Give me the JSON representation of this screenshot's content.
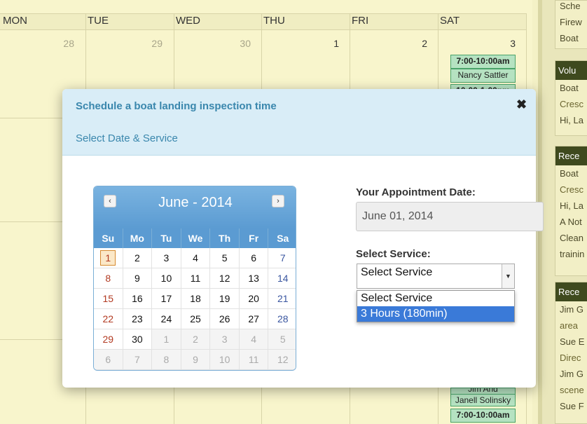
{
  "background": {
    "day_names": [
      "MON",
      "TUE",
      "WED",
      "THU",
      "FRI",
      "SAT"
    ],
    "dates_top_row": [
      {
        "label": "28",
        "muted": true
      },
      {
        "label": "29",
        "muted": true
      },
      {
        "label": "30",
        "muted": true
      },
      {
        "label": "1",
        "muted": false
      },
      {
        "label": "2",
        "muted": false
      },
      {
        "label": "3",
        "muted": false
      }
    ],
    "events_top": [
      "7:00-10:00am",
      "Nancy Sattler",
      "10:00-1:00pm"
    ],
    "events_bottom": [
      "Jim And",
      "Janell Solinsky",
      "7:00-10:00am"
    ]
  },
  "sidebar": {
    "box1": [
      "Sche",
      "Firew",
      "Boat"
    ],
    "box2_head": "Volu",
    "box2": [
      "Boat",
      "Cresc",
      "Hi, La"
    ],
    "box3_head": "Rece",
    "box3": [
      "Boat",
      "Cresc",
      "Hi, La",
      "A Not",
      "Clean",
      "trainin"
    ],
    "box4_head": "Rece",
    "box4": [
      "Jim G",
      "area",
      "Sue E",
      "Direc",
      "Jim G",
      "scene",
      "Sue F"
    ]
  },
  "modal": {
    "title": "Schedule a boat landing inspection time",
    "close_symbol": "✖",
    "subtitle": "Select Date & Service",
    "datepicker": {
      "prev_symbol": "‹",
      "next_symbol": "›",
      "title": "June - 2014",
      "weekdays": [
        "Su",
        "Mo",
        "Tu",
        "We",
        "Th",
        "Fr",
        "Sa"
      ],
      "weeks": [
        [
          "1",
          "2",
          "3",
          "4",
          "5",
          "6",
          "7"
        ],
        [
          "8",
          "9",
          "10",
          "11",
          "12",
          "13",
          "14"
        ],
        [
          "15",
          "16",
          "17",
          "18",
          "19",
          "20",
          "21"
        ],
        [
          "22",
          "23",
          "24",
          "25",
          "26",
          "27",
          "28"
        ],
        [
          "29",
          "30",
          "1",
          "2",
          "3",
          "4",
          "5"
        ],
        [
          "6",
          "7",
          "8",
          "9",
          "10",
          "11",
          "12"
        ]
      ],
      "selected": "1"
    },
    "appointment_label": "Your Appointment Date:",
    "appointment_value": "June 01, 2014",
    "service_label": "Select Service:",
    "service_selected": "Select Service",
    "service_options": [
      "Select Service",
      "3 Hours (180min)"
    ],
    "highlighted_option": "3 Hours (180min)"
  }
}
